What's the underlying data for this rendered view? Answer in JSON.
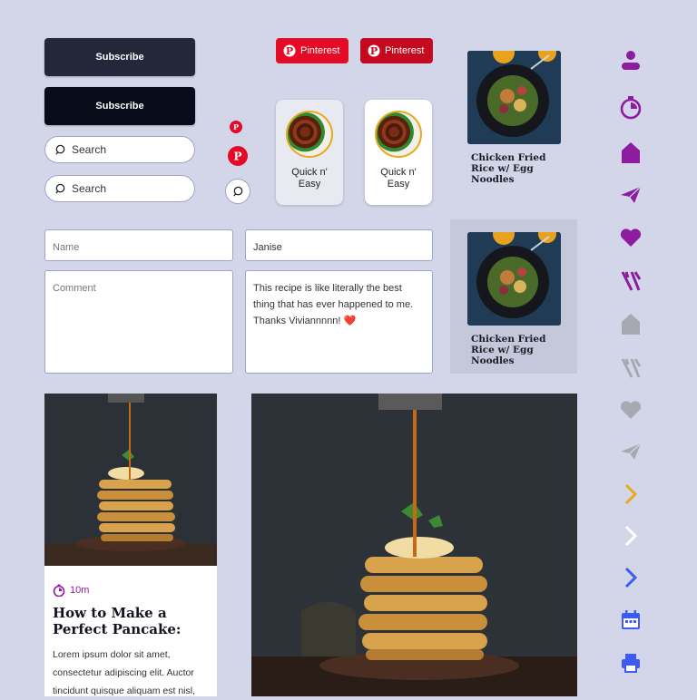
{
  "subscribe_buttons": [
    {
      "label": "Subscribe",
      "color": "#22273a"
    },
    {
      "label": "Subscribe",
      "color": "#070b1a"
    }
  ],
  "search_pills": [
    {
      "placeholder": "Search"
    },
    {
      "placeholder": "Search"
    }
  ],
  "pinterest_buttons": [
    {
      "label": "Pinterest",
      "color": "#e30b25"
    },
    {
      "label": "Pinterest",
      "color": "#c40a1e"
    }
  ],
  "quick_cards": [
    {
      "label": "Quick n' Easy",
      "background": "#e9eaf1"
    },
    {
      "label": "Quick n' Easy",
      "background": "#ffffff"
    }
  ],
  "recipe_cards": [
    {
      "title": "Chicken Fried Rice w/ Egg Noodles",
      "image_icon": "noodle-bowl-image"
    },
    {
      "title": "Chicken Fried Rice w/ Egg Noodles",
      "image_icon": "noodle-bowl-image"
    }
  ],
  "comment_form": {
    "name_placeholder": "Name",
    "comment_placeholder": "Comment",
    "filled_name": "Janise",
    "filled_comment": "This recipe is like literally the best thing that has ever happened to me. Thanks Viviannnnn! ❤️"
  },
  "pancake_card": {
    "time": "10m",
    "title": "How to Make a Perfect Pancake:",
    "body": "Lorem ipsum dolor sit amet, consectetur adipiscing elit. Auctor tincidunt quisque aliquam est nisl,"
  },
  "icons": [
    {
      "name": "user-icon",
      "color": "#8e1c9e"
    },
    {
      "name": "timer-icon",
      "color": "#8e1c9e"
    },
    {
      "name": "home-icon",
      "color": "#8e1c9e"
    },
    {
      "name": "send-icon",
      "color": "#8e1c9e"
    },
    {
      "name": "heart-icon",
      "color": "#8e1c9e"
    },
    {
      "name": "utensils-icon",
      "color": "#8e1c9e"
    },
    {
      "name": "home-icon",
      "color": "#a7a9b1"
    },
    {
      "name": "utensils-icon",
      "color": "#a7a9b1"
    },
    {
      "name": "heart-icon",
      "color": "#a7a9b1"
    },
    {
      "name": "send-icon",
      "color": "#a7a9b1"
    },
    {
      "name": "chevron-right-icon",
      "color": "#e8a91f"
    },
    {
      "name": "chevron-right-icon",
      "color": "#ffffff"
    },
    {
      "name": "chevron-right-icon",
      "color": "#3d5af1"
    },
    {
      "name": "calendar-icon",
      "color": "#3d5af1"
    },
    {
      "name": "printer-icon",
      "color": "#3d5af1"
    }
  ],
  "colors": {
    "page_background": "#d3d6e8",
    "brand_purple": "#8e1c9e",
    "pinterest_red": "#e30b25",
    "accent_blue": "#3d5af1"
  }
}
